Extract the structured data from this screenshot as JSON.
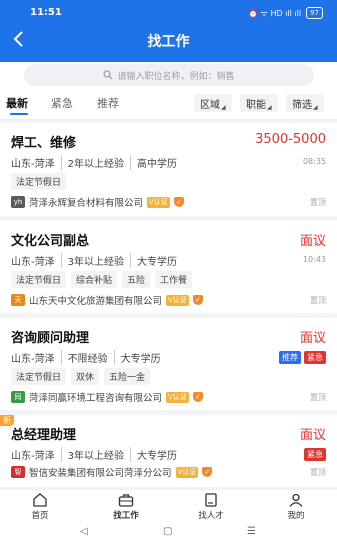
{
  "status_bar": {
    "time": "11:51",
    "icons": "⏰ ᯤ HD ıll ıll",
    "battery": "97"
  },
  "header": {
    "title": "找工作"
  },
  "search": {
    "placeholder": "请输入职位名称，例如：销售"
  },
  "tabs": [
    {
      "label": "最新",
      "active": true
    },
    {
      "label": "紧急",
      "active": false
    },
    {
      "label": "推荐",
      "active": false
    }
  ],
  "filters": [
    {
      "label": "区域"
    },
    {
      "label": "职能"
    },
    {
      "label": "筛选"
    }
  ],
  "jobs": [
    {
      "title": "焊工、维修",
      "salary": "3500-5000",
      "meta": [
        "山东-菏泽",
        "2年以上经验",
        "高中学历"
      ],
      "time": "08:35",
      "tags": [
        "法定节假日"
      ],
      "company": "菏泽永辉复合材料有限公司",
      "company_logo_text": "yh",
      "top_label": "置顶"
    },
    {
      "title": "文化公司副总",
      "salary": "面议",
      "meta": [
        "山东-菏泽",
        "3年以上经验",
        "大专学历"
      ],
      "time": "10:43",
      "tags": [
        "法定节假日",
        "综合补贴",
        "五险",
        "工作餐"
      ],
      "company": "山东天中文化旅游集团有限公司",
      "company_logo_text": "天",
      "top_label": "置顶"
    },
    {
      "title": "咨询顾问助理",
      "salary": "面议",
      "meta": [
        "山东-菏泽",
        "不限经验",
        "大专学历"
      ],
      "badges": [
        "推荐",
        "紧急"
      ],
      "tags": [
        "法定节假日",
        "双休",
        "五险一金"
      ],
      "company": "菏泽同赢环境工程咨询有限公司",
      "company_logo_text": "同",
      "top_label": "置顶"
    },
    {
      "title": "总经理助理",
      "salary": "面议",
      "meta": [
        "山东-菏泽",
        "3年以上经验",
        "大专学历"
      ],
      "badges": [
        "紧急"
      ],
      "new_label": "新",
      "company": "智信安装集团有限公司菏泽分公司",
      "company_logo_text": "智",
      "top_label": "置顶"
    }
  ],
  "verify_badge": "V认证",
  "nav": [
    {
      "label": "首页",
      "icon": "home-icon"
    },
    {
      "label": "找工作",
      "icon": "briefcase-icon"
    },
    {
      "label": "找人才",
      "icon": "resume-icon"
    },
    {
      "label": "我的",
      "icon": "user-icon"
    }
  ],
  "colors": {
    "primary": "#1e73e8",
    "salary": "#e0342e",
    "badge_blue": "#2a6df0",
    "badge_red": "#e0342e"
  }
}
